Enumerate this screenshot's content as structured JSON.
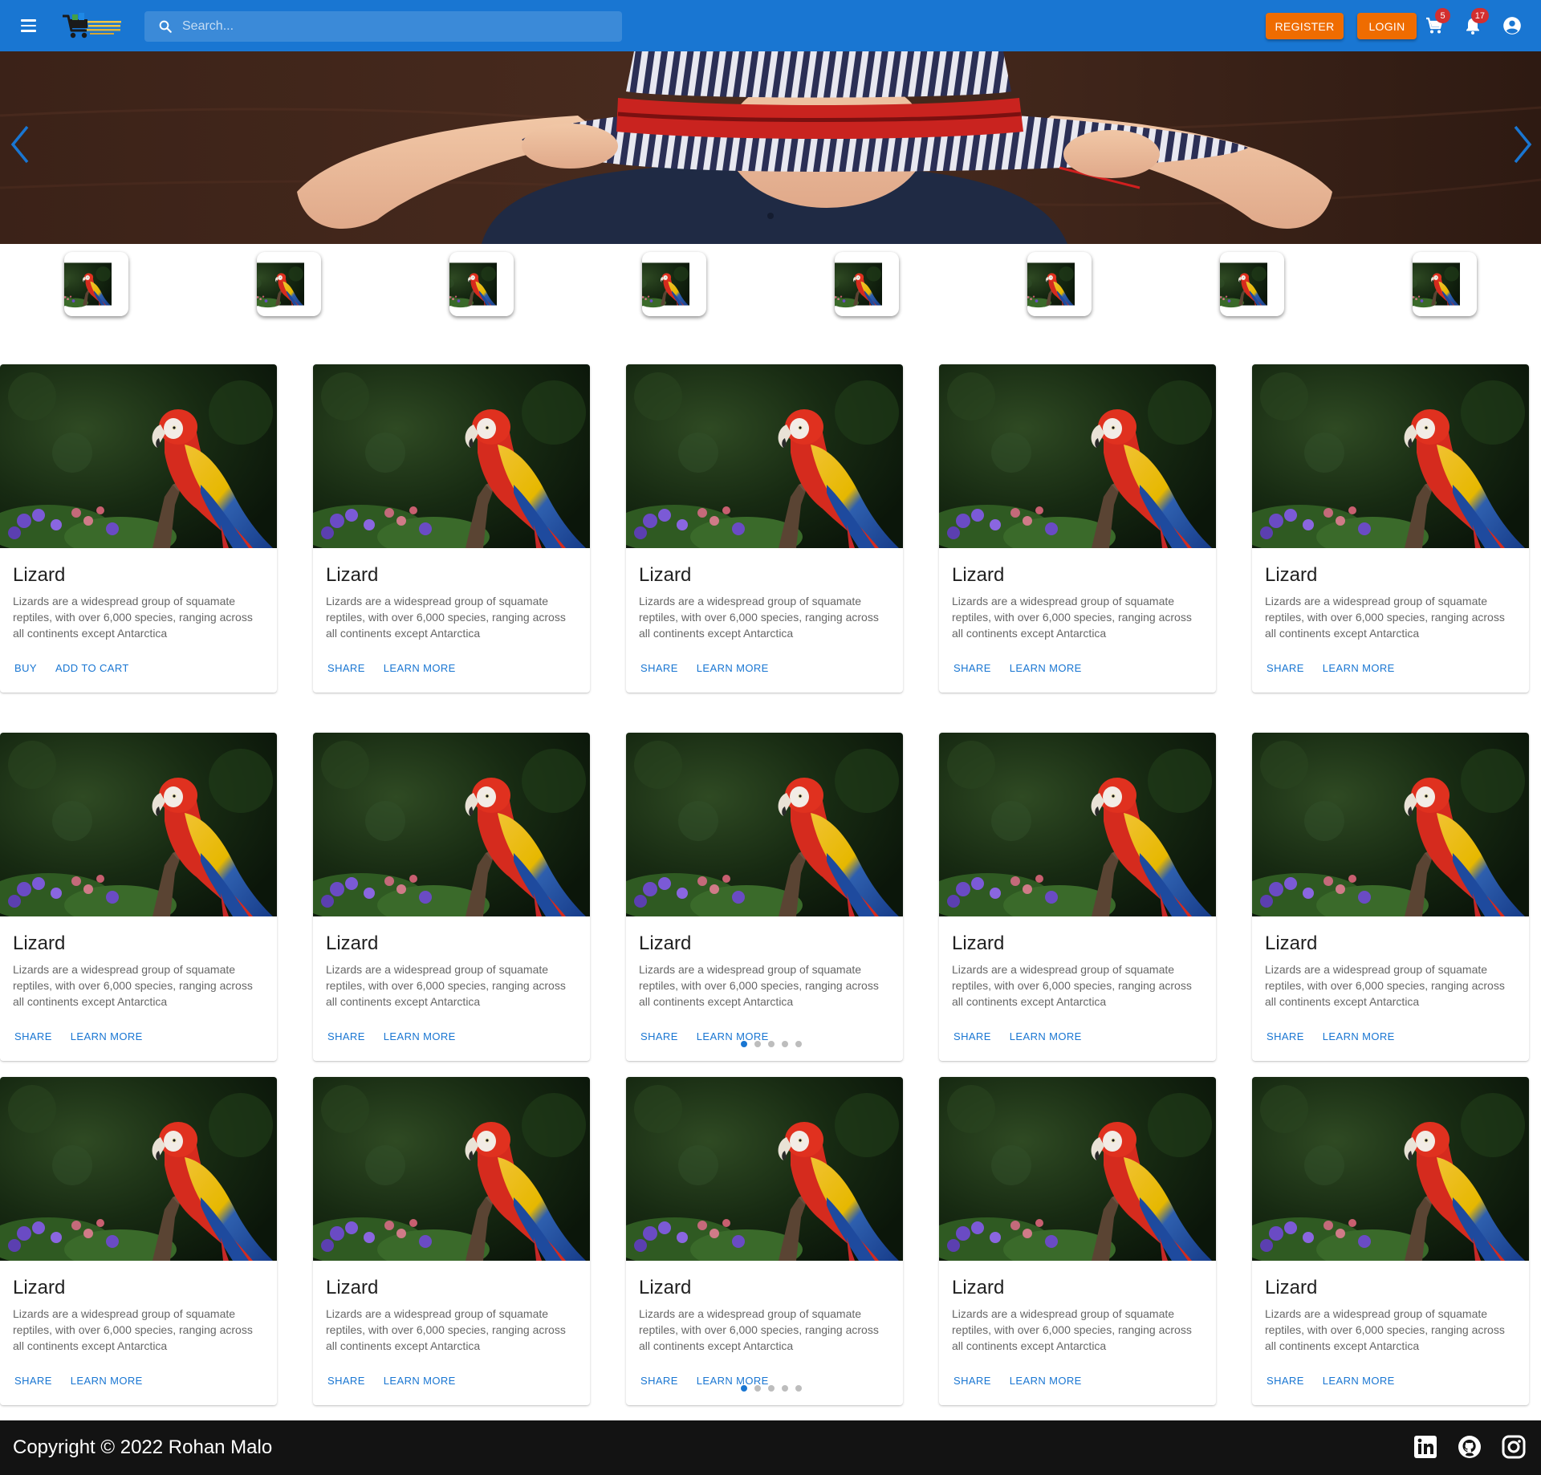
{
  "header": {
    "search_placeholder": "Search...",
    "register_label": "REGISTER",
    "login_label": "LOGIN",
    "cart_count": "5",
    "notification_count": "17",
    "colors": {
      "appbar": "#1976d2",
      "accent": "#ef6c00",
      "badge": "#d32f2f"
    }
  },
  "hero": {
    "image": "boy-in-striped-hat",
    "prev_icon": "chevron-left-icon",
    "next_icon": "chevron-right-icon"
  },
  "thumbnails": [
    "parrot",
    "parrot",
    "parrot",
    "parrot",
    "parrot",
    "parrot",
    "parrot",
    "parrot"
  ],
  "cards": [
    {
      "title": "Lizard",
      "description": "Lizards are a widespread group of squamate reptiles, with over 6,000 species, ranging across all continents except Antarctica",
      "actions": [
        "BUY",
        "ADD TO CART"
      ]
    },
    {
      "title": "Lizard",
      "description": "Lizards are a widespread group of squamate reptiles, with over 6,000 species, ranging across all continents except Antarctica",
      "actions": [
        "SHARE",
        "LEARN MORE"
      ]
    },
    {
      "title": "Lizard",
      "description": "Lizards are a widespread group of squamate reptiles, with over 6,000 species, ranging across all continents except Antarctica",
      "actions": [
        "SHARE",
        "LEARN MORE"
      ]
    },
    {
      "title": "Lizard",
      "description": "Lizards are a widespread group of squamate reptiles, with over 6,000 species, ranging across all continents except Antarctica",
      "actions": [
        "SHARE",
        "LEARN MORE"
      ]
    },
    {
      "title": "Lizard",
      "description": "Lizards are a widespread group of squamate reptiles, with over 6,000 species, ranging across all continents except Antarctica",
      "actions": [
        "SHARE",
        "LEARN MORE"
      ]
    },
    {
      "title": "Lizard",
      "description": "Lizards are a widespread group of squamate reptiles, with over 6,000 species, ranging across all continents except Antarctica",
      "actions": [
        "SHARE",
        "LEARN MORE"
      ]
    },
    {
      "title": "Lizard",
      "description": "Lizards are a widespread group of squamate reptiles, with over 6,000 species, ranging across all continents except Antarctica",
      "actions": [
        "SHARE",
        "LEARN MORE"
      ]
    },
    {
      "title": "Lizard",
      "description": "Lizards are a widespread group of squamate reptiles, with over 6,000 species, ranging across all continents except Antarctica",
      "actions": [
        "SHARE",
        "LEARN MORE"
      ]
    },
    {
      "title": "Lizard",
      "description": "Lizards are a widespread group of squamate reptiles, with over 6,000 species, ranging across all continents except Antarctica",
      "actions": [
        "SHARE",
        "LEARN MORE"
      ]
    },
    {
      "title": "Lizard",
      "description": "Lizards are a widespread group of squamate reptiles, with over 6,000 species, ranging across all continents except Antarctica",
      "actions": [
        "SHARE",
        "LEARN MORE"
      ]
    },
    {
      "title": "Lizard",
      "description": "Lizards are a widespread group of squamate reptiles, with over 6,000 species, ranging across all continents except Antarctica",
      "actions": [
        "SHARE",
        "LEARN MORE"
      ]
    },
    {
      "title": "Lizard",
      "description": "Lizards are a widespread group of squamate reptiles, with over 6,000 species, ranging across all continents except Antarctica",
      "actions": [
        "SHARE",
        "LEARN MORE"
      ]
    },
    {
      "title": "Lizard",
      "description": "Lizards are a widespread group of squamate reptiles, with over 6,000 species, ranging across all continents except Antarctica",
      "actions": [
        "SHARE",
        "LEARN MORE"
      ]
    },
    {
      "title": "Lizard",
      "description": "Lizards are a widespread group of squamate reptiles, with over 6,000 species, ranging across all continents except Antarctica",
      "actions": [
        "SHARE",
        "LEARN MORE"
      ]
    },
    {
      "title": "Lizard",
      "description": "Lizards are a widespread group of squamate reptiles, with over 6,000 species, ranging across all continents except Antarctica",
      "actions": [
        "SHARE",
        "LEARN MORE"
      ]
    }
  ],
  "carousel_dots": {
    "count": 5,
    "active": 0
  },
  "footer": {
    "copyright": "Copyright © 2022 Rohan Malo",
    "social": [
      "linkedin-icon",
      "github-icon",
      "instagram-icon"
    ]
  }
}
